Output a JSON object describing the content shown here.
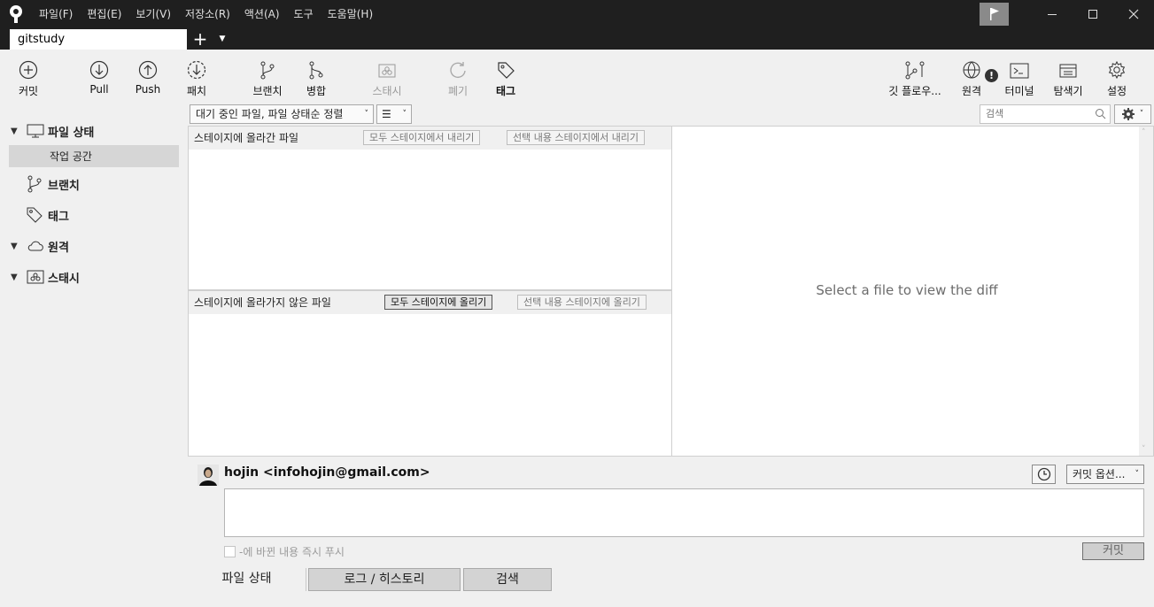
{
  "menu": [
    "파일(F)",
    "편집(E)",
    "보기(V)",
    "저장소(R)",
    "액션(A)",
    "도구",
    "도움말(H)"
  ],
  "tab": {
    "title": "gitstudy"
  },
  "toolbar": {
    "commit": "커밋",
    "pull": "Pull",
    "push": "Push",
    "fetch": "패치",
    "branch": "브랜치",
    "merge": "병합",
    "stash": "스태시",
    "discard": "폐기",
    "tag": "태그",
    "gitflow": "깃 플로우...",
    "remote": "원격",
    "terminal": "터미널",
    "explorer": "탐색기",
    "settings": "설정"
  },
  "sidebar": {
    "file_status": "파일 상태",
    "workspace": "작업 공간",
    "branches": "브랜치",
    "tags": "태그",
    "remotes": "원격",
    "stashes": "스태시"
  },
  "filter": {
    "sort": "대기 중인 파일, 파일 상태순 정렬",
    "search_placeholder": "검색"
  },
  "staged": {
    "title": "스테이지에 올라간 파일",
    "unstage_all": "모두 스테이지에서 내리기",
    "unstage_selected": "선택 내용 스테이지에서 내리기"
  },
  "unstaged": {
    "title": "스테이지에 올라가지 않은 파일",
    "stage_all": "모두 스테이지에 올리기",
    "stage_selected": "선택 내용 스테이지에 올리기"
  },
  "diff": {
    "message": "Select a file to view the diff"
  },
  "commit": {
    "author": "hojin <infohojin@gmail.com>",
    "options": "커밋 옵션...",
    "push_label": "-에 바뀐 내용 즉시 푸시",
    "button": "커밋"
  },
  "bottom_tabs": {
    "file_status": "파일 상태",
    "log": "로그 / 히스토리",
    "search": "검색"
  }
}
